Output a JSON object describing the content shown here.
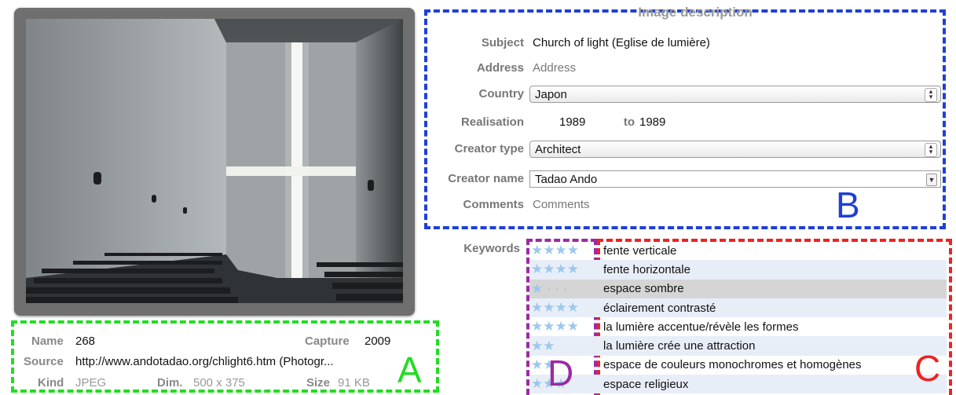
{
  "description": {
    "title": "Image description",
    "subject": {
      "label": "Subject",
      "value": "Church of light (Eglise de lumière)"
    },
    "address": {
      "label": "Address",
      "value": "Address"
    },
    "country": {
      "label": "Country",
      "value": "Japon"
    },
    "realisation": {
      "label": "Realisation",
      "from": "1989",
      "to_label": "to",
      "to": "1989"
    },
    "creator_type": {
      "label": "Creator type",
      "value": "Architect"
    },
    "creator_name": {
      "label": "Creator name",
      "value": "Tadao Ando"
    },
    "comments": {
      "label": "Comments",
      "value": "Comments"
    }
  },
  "keywords": {
    "label": "Keywords",
    "items": [
      {
        "stars": "★★★★",
        "rating": 4,
        "text": "fente verticale"
      },
      {
        "stars": "★★★★",
        "rating": 4,
        "text": "fente horizontale"
      },
      {
        "stars": "★",
        "rating": 1,
        "text": "espace sombre"
      },
      {
        "stars": "★★★★",
        "rating": 4,
        "text": "éclairement contrasté"
      },
      {
        "stars": "★★★★",
        "rating": 4,
        "text": "la lumière accentue/révèle les formes"
      },
      {
        "stars": "★★",
        "rating": 2,
        "text": "la lumière crée une attraction"
      },
      {
        "stars": "★★",
        "rating": 2,
        "text": "espace de couleurs monochromes et homogènes"
      },
      {
        "stars": "★★★",
        "rating": 3,
        "text": "espace religieux"
      }
    ]
  },
  "info": {
    "name": {
      "label": "Name",
      "value": "268"
    },
    "capture": {
      "label": "Capture",
      "value": "2009"
    },
    "source": {
      "label": "Source",
      "value": "http://www.andotadao.org/chlight6.htm (Photogr..."
    },
    "kind": {
      "label": "Kind",
      "value": "JPEG"
    },
    "dim": {
      "label": "Dim.",
      "value": "500 x 375"
    },
    "size": {
      "label": "Size",
      "value": "91 KB"
    }
  },
  "annotations": {
    "a": "A",
    "b": "B",
    "c": "C",
    "d": "D"
  },
  "colors": {
    "box_a": "#22dd22",
    "box_b": "#1f3fd6",
    "box_c": "#ee2222",
    "box_d": "#9b2aa3"
  }
}
